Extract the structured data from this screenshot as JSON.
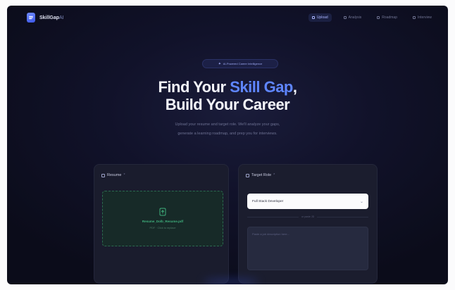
{
  "brand": {
    "name": "SkillGap",
    "suffix": "AI"
  },
  "nav": [
    {
      "label": "Upload",
      "active": true
    },
    {
      "label": "Analysis",
      "active": false
    },
    {
      "label": "Roadmap",
      "active": false
    },
    {
      "label": "Interview",
      "active": false
    }
  ],
  "hero": {
    "badge": "AI-Powered Career Intelligence",
    "title_prefix": "Find Your ",
    "title_accent": "Skill Gap",
    "title_suffix": ",",
    "title_line2": "Build Your Career",
    "subtitle_line1": "Upload your resume and target role. We'll analyze your gaps,",
    "subtitle_line2": "generate a learning roadmap, and prep you for interviews."
  },
  "resume_card": {
    "title": "Resume",
    "required": "*",
    "drop_main": "Resume_Dolb_Resume.pdf",
    "drop_sub": "PDF · Click to replace"
  },
  "target_card": {
    "title": "Target Role",
    "required": "*",
    "selected_role": "Full Stack Developer",
    "divider": "or paste JD",
    "textarea_placeholder": "Paste a job description here..."
  },
  "colors": {
    "accent": "#5f86ff",
    "background": "#0b0c1a",
    "success": "#3fb07c"
  }
}
